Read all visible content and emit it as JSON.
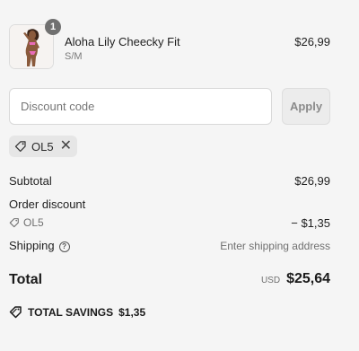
{
  "product": {
    "quantity": "1",
    "name": "Aloha Lily Cheecky Fit",
    "variant": "S/M",
    "price": "$26,99"
  },
  "discount": {
    "placeholder": "Discount code",
    "apply_label": "Apply",
    "applied_code": "OL5"
  },
  "summary": {
    "subtotal_label": "Subtotal",
    "subtotal_value": "$26,99",
    "order_discount_label": "Order discount",
    "discount_code": "OL5",
    "discount_value": "− $1,35",
    "shipping_label": "Shipping",
    "shipping_value": "Enter shipping address",
    "total_label": "Total",
    "currency": "USD",
    "total_value": "$25,64",
    "savings_label": "TOTAL SAVINGS",
    "savings_value": "$1,35"
  },
  "colors": {
    "background": "#f5f5f5",
    "badge": "#707070",
    "chip": "#e6e6e6"
  },
  "icons": [
    "tag-icon",
    "close-icon",
    "help-circle-icon",
    "discount-tag-icon"
  ]
}
